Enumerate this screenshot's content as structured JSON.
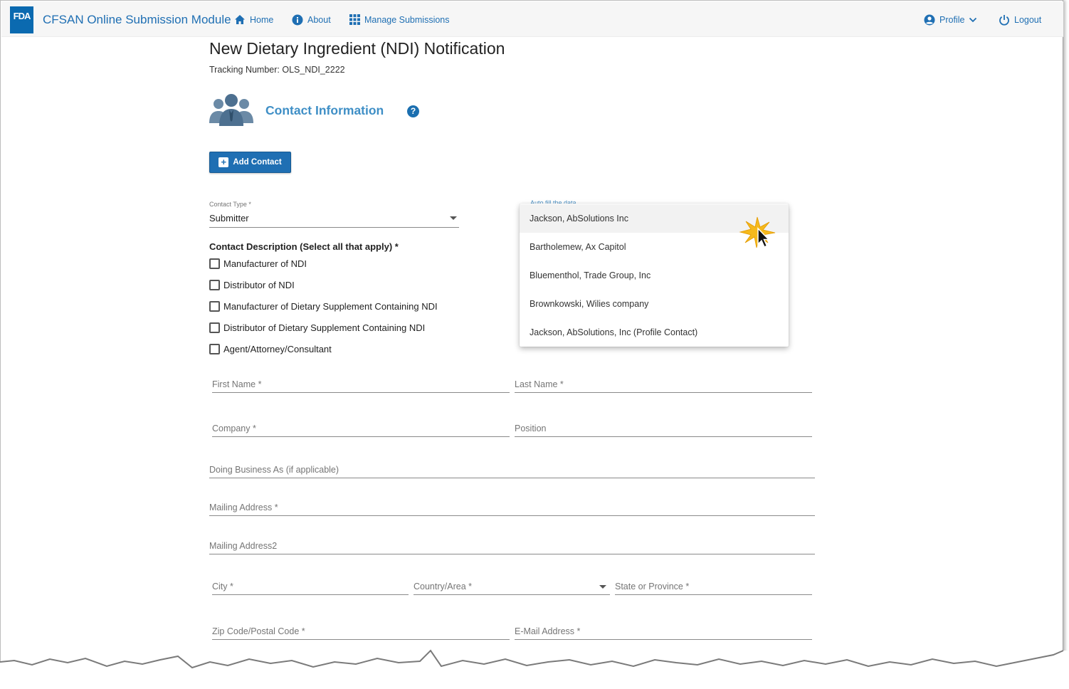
{
  "header": {
    "logo_text": "FDA",
    "app_title": "CFSAN Online Submission Module",
    "nav": {
      "home": "Home",
      "about": "About",
      "manage": "Manage Submissions",
      "profile": "Profile",
      "logout": "Logout"
    }
  },
  "page": {
    "title": "New Dietary Ingredient (NDI) Notification",
    "tracking": "Tracking Number: OLS_NDI_2222"
  },
  "section": {
    "title": "Contact Information",
    "help": "?"
  },
  "add_contact": {
    "label": "Add Contact"
  },
  "contact_type": {
    "label": "Contact Type *",
    "value": "Submitter"
  },
  "autofill": {
    "label": "Auto fill the data"
  },
  "autofill_options": [
    "Jackson, AbSolutions Inc",
    "Bartholemew, Ax Capitol",
    "Bluementhol, Trade Group, Inc",
    "Brownkowski, Wilies company",
    "Jackson, AbSolutions, Inc (Profile Contact)"
  ],
  "description": {
    "label": "Contact Description (Select all that apply) *",
    "options": [
      "Manufacturer of NDI",
      "Distributor of NDI",
      "Manufacturer of Dietary Supplement Containing NDI",
      "Distributor of Dietary Supplement Containing NDI",
      "Agent/Attorney/Consultant"
    ]
  },
  "fields": {
    "first_name": "First Name *",
    "last_name": "Last Name *",
    "company": "Company *",
    "position": "Position",
    "dba": "Doing Business As (if applicable)",
    "mailing1": "Mailing Address *",
    "mailing2": "Mailing Address2",
    "city": "City *",
    "country": "Country/Area *",
    "state": "State or Province *",
    "zip": "Zip Code/Postal Code *",
    "email": "E-Mail Address *"
  },
  "colors": {
    "brand_blue": "#1f6fb3",
    "section_blue": "#3f8fc6",
    "header_bg": "#f6f6f6"
  }
}
